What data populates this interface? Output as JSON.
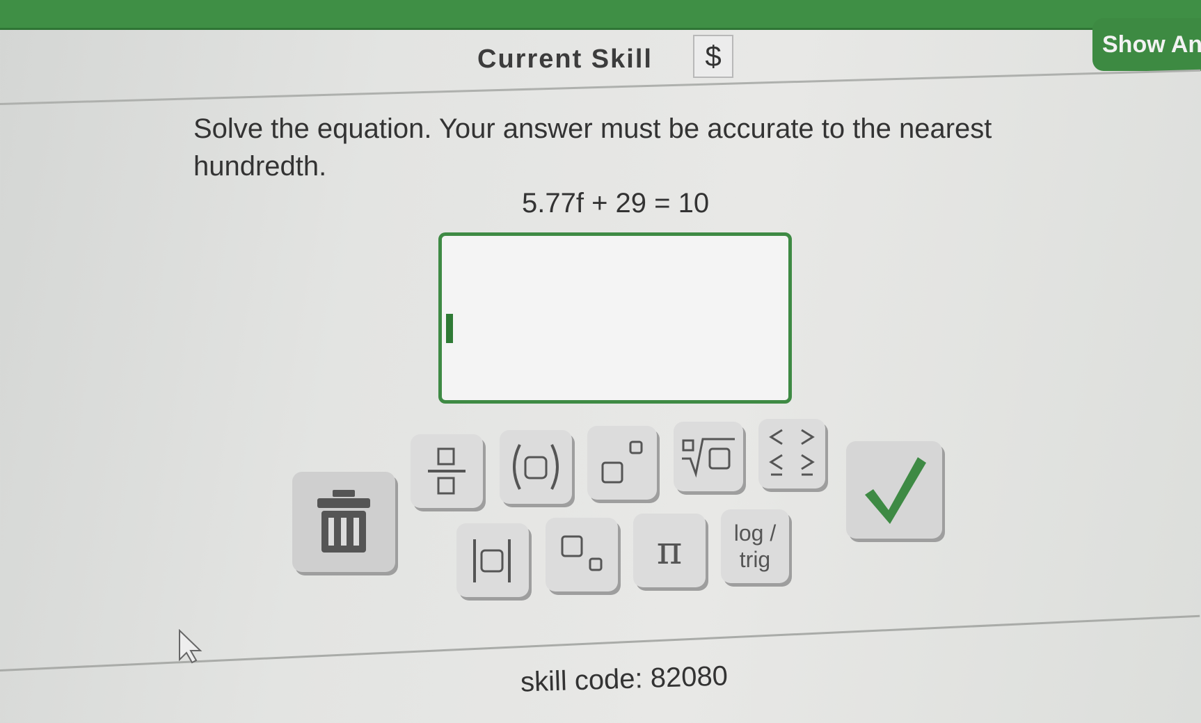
{
  "header": {
    "title": "Current Skill",
    "currency_symbol": "$",
    "show_answer_label": "Show An"
  },
  "question": {
    "prompt": "Solve the equation. Your answer must be accurate to the nearest hundredth.",
    "equation": "5.77f + 29 = 10"
  },
  "answer_input": {
    "value": ""
  },
  "keypad": {
    "accent_color": "#3e8a44",
    "keys": [
      {
        "name": "trash",
        "icon": "trash-icon"
      },
      {
        "name": "fraction",
        "icon": "fraction-icon"
      },
      {
        "name": "parentheses",
        "icon": "parentheses-icon"
      },
      {
        "name": "exponent",
        "icon": "exponent-icon"
      },
      {
        "name": "nth-root",
        "icon": "nth-root-icon"
      },
      {
        "name": "inequality",
        "icon": "inequality-icon"
      },
      {
        "name": "absolute-value",
        "icon": "absolute-value-icon"
      },
      {
        "name": "subscript",
        "icon": "subscript-icon"
      },
      {
        "name": "pi",
        "label": "π"
      },
      {
        "name": "log-trig",
        "label_line1": "log /",
        "label_line2": "trig"
      },
      {
        "name": "submit",
        "icon": "check-icon"
      }
    ]
  },
  "footer": {
    "skill_code": "skill code: 82080"
  }
}
